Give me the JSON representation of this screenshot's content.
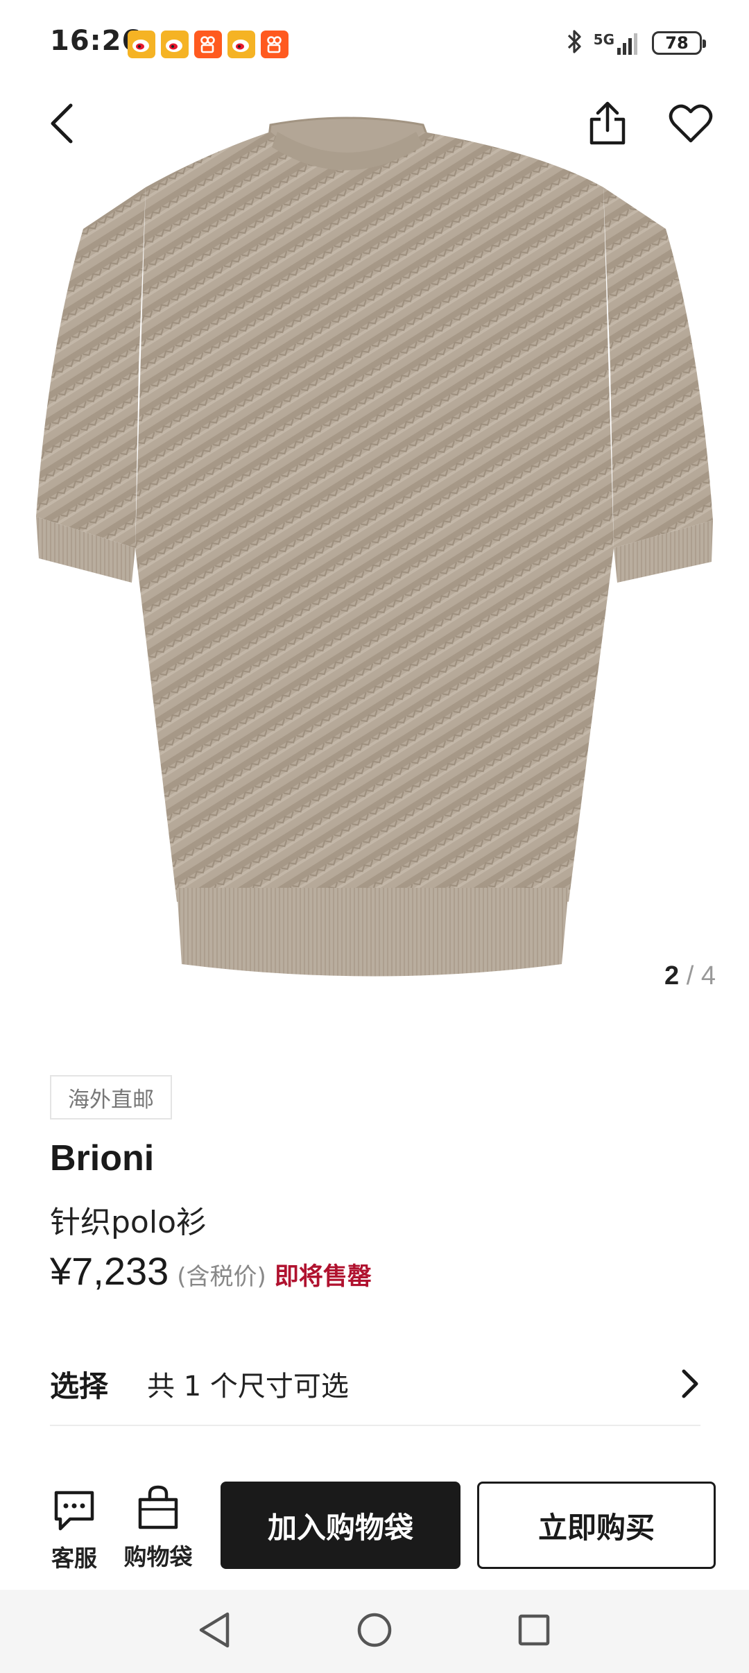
{
  "status_bar": {
    "time": "16:26",
    "notifications": [
      "weibo-icon",
      "weibo-icon",
      "kuaishou-icon",
      "weibo-icon",
      "kuaishou-icon"
    ],
    "network": "5G",
    "battery": "78"
  },
  "nav": {
    "back_icon": "chevron-left-icon",
    "share_icon": "share-icon",
    "favorite_icon": "heart-icon"
  },
  "gallery": {
    "current": "2",
    "separator": "/",
    "total": "4"
  },
  "product": {
    "badge": "海外直邮",
    "brand": "Brioni",
    "name": "针织polo衫",
    "price": "¥7,233",
    "tax_note": "(含税价)",
    "stock_status": "即将售罄"
  },
  "selection": {
    "label": "选择",
    "value": "共 1 个尺寸可选"
  },
  "actions": {
    "customer_service": "客服",
    "shopping_bag": "购物袋",
    "add_to_bag": "加入购物袋",
    "buy_now": "立即购买"
  },
  "colors": {
    "accent_dark": "#1a1a1a",
    "stock_warning": "#b0122f",
    "garment": "#b5a898"
  }
}
